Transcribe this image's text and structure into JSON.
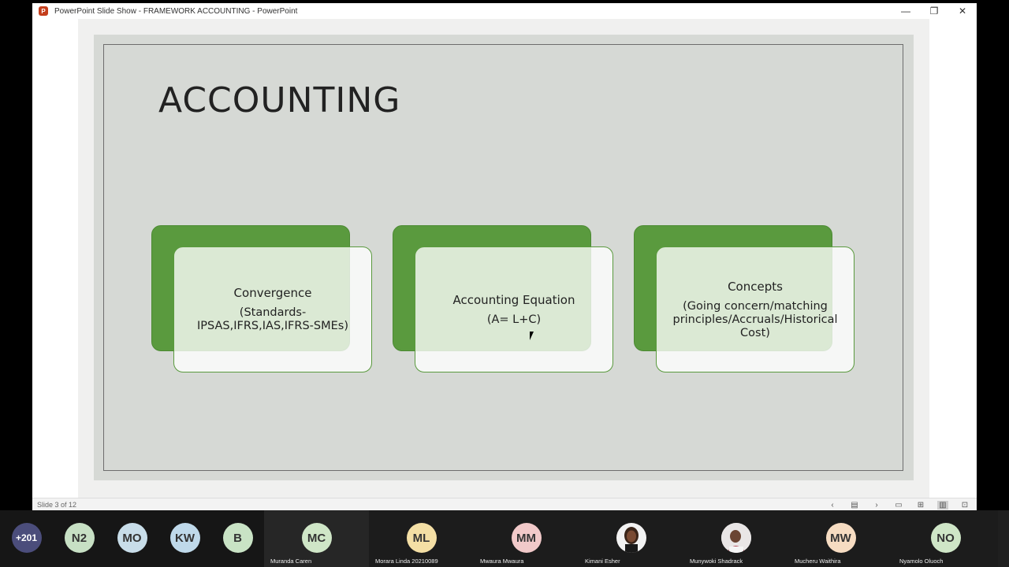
{
  "window": {
    "title": "PowerPoint Slide Show  -  FRAMEWORK ACCOUNTING  -  PowerPoint",
    "icon_letter": "P",
    "controls": {
      "minimize": "—",
      "restore": "❐",
      "close": "✕"
    }
  },
  "slide": {
    "title": "ACCOUNTING",
    "cards": [
      {
        "title": "Convergence",
        "body": "(Standards-IPSAS,IFRS,IAS,IFRS-SMEs)"
      },
      {
        "title": "Accounting Equation",
        "body": "(A= L+C)"
      },
      {
        "title": "Concepts",
        "body": "(Going concern/matching principles/Accruals/Historical Cost)"
      }
    ],
    "colors": {
      "accent": "#5a9a3e",
      "background": "#d6d9d5"
    }
  },
  "statusbar": {
    "slide_count": "Slide 3 of 12",
    "icons": [
      "chevron-left-icon",
      "slide-menu-icon",
      "chevron-right-icon",
      "normal-view-icon",
      "slide-sorter-icon",
      "reading-view-icon",
      "slideshow-icon"
    ]
  },
  "participants": [
    {
      "initials": "+201",
      "name": "",
      "color": "#4b4d7b"
    },
    {
      "initials": "N2",
      "name": "",
      "color": "#c7e0c4"
    },
    {
      "initials": "MO",
      "name": "",
      "color": "#c8dde9"
    },
    {
      "initials": "KW",
      "name": "",
      "color": "#bfd9ea"
    },
    {
      "initials": "B",
      "name": "",
      "color": "#c9e3c5"
    },
    {
      "initials": "MC",
      "name": "Muranda Caren",
      "color": "#cfe6c7"
    },
    {
      "initials": "ML",
      "name": "Morara Linda 20210089",
      "color": "#f4dfa5"
    },
    {
      "initials": "MM",
      "name": "Mwaura Mwaura",
      "color": "#f1c9c9"
    },
    {
      "initials": "",
      "name": "Kimani Esher",
      "color": "#2b1a14"
    },
    {
      "initials": "",
      "name": "Munywoki Shadrack",
      "color": "#e9e6e6"
    },
    {
      "initials": "MW",
      "name": "Mucheru Waithira",
      "color": "#f6dcc2"
    },
    {
      "initials": "NO",
      "name": "Nyamolo Oluoch",
      "color": "#cfe6c7"
    }
  ]
}
